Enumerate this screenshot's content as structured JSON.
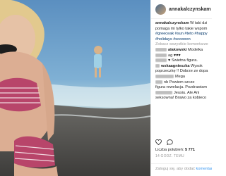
{
  "post": {
    "username": "annakalczynskam",
    "caption_lines": [
      "W taki dzi",
      "pomaga mi tylko takie wspom",
      "#greeceak #sun #teto #happy",
      "#holidays #sooooon"
    ],
    "view_all_comments": "Zobacz wszystkie komentarze"
  },
  "comments": [
    {
      "user": "alakowski",
      "text": "Modelka"
    },
    {
      "user": "",
      "text": "ag ♥♥♥"
    },
    {
      "user": "",
      "text": "♥ Świetna figura."
    },
    {
      "user": "wskaagnieszka",
      "text": "Wysok"
    },
    {
      "user": "",
      "text": "poprzeczkę !! Dobrze ze dopa"
    },
    {
      "user": "",
      "text": "Mega"
    },
    {
      "user": "",
      "text": "nb Powiem szcze"
    },
    {
      "user": "",
      "text": "figura rewelacja. Pozdrawiam"
    },
    {
      "user": "",
      "text": "Jeusiu. Ale Ani"
    },
    {
      "user": "",
      "text": "seksowna! Brawo za kobieco"
    }
  ],
  "likes": {
    "label": "Liczba polubień:",
    "count": "5 771"
  },
  "date": "14 GODZ. TEMU",
  "login_prompt": {
    "prefix": "Zaloguj się, aby dodać ",
    "link": "komentarz"
  },
  "icons": [
    "heart-icon",
    "comment-icon"
  ],
  "colors": {
    "link": "#003569",
    "button_blue": "#3897f0",
    "text": "#262626",
    "muted": "#999999"
  }
}
